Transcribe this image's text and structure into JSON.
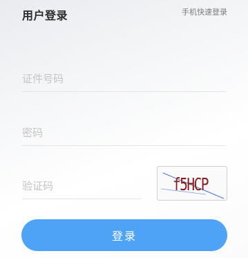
{
  "header": {
    "title": "用户登录",
    "quick_login_link": "手机快速登录"
  },
  "form": {
    "id_number": {
      "placeholder": "证件号码",
      "value": ""
    },
    "password": {
      "placeholder": "密码",
      "value": ""
    },
    "captcha": {
      "placeholder": "验证码",
      "value": "",
      "image_text": "f5HCP"
    }
  },
  "submit_label": "登录",
  "colors": {
    "accent": "#4ea3f7",
    "captcha_text": "#8b1a1a"
  }
}
